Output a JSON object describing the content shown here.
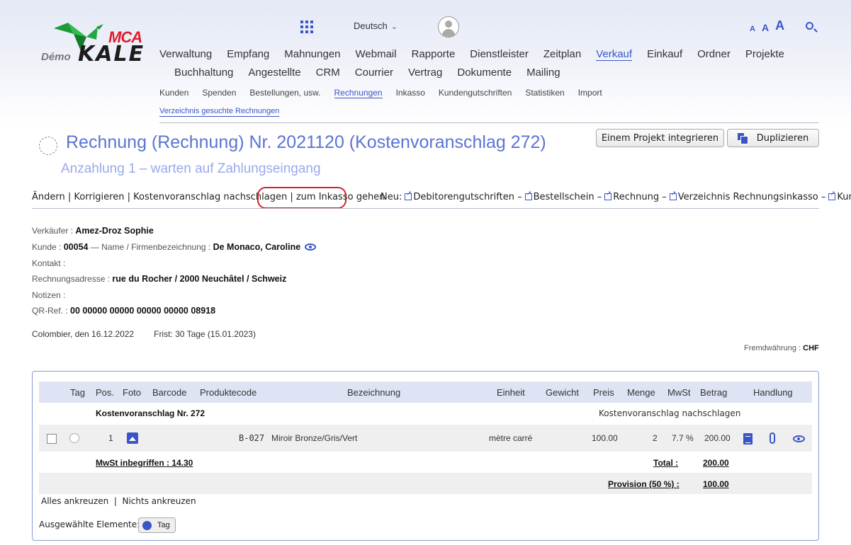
{
  "logo": {
    "brand_top": "MCA",
    "brand_prefix": "Démo",
    "brand_main": "KALE"
  },
  "header": {
    "language": "Deutsch",
    "font_sizes": [
      "A",
      "A",
      "A"
    ]
  },
  "nav_main": [
    "Verwaltung",
    "Empfang",
    "Mahnungen",
    "Webmail",
    "Rapporte",
    "Dienstleister",
    "Zeitplan",
    "Verkauf",
    "Einkauf",
    "Ordner",
    "Projekte"
  ],
  "nav_main_row2": [
    "Buchhaltung",
    "Angestellte",
    "CRM",
    "Courrier",
    "Vertrag",
    "Dokumente",
    "Mailing"
  ],
  "nav_sub": [
    "Kunden",
    "Spenden",
    "Bestellungen, usw.",
    "Rechnungen",
    "Inkasso",
    "Kundengutschriften",
    "Statistiken",
    "Import"
  ],
  "nav_sub2": "Verzeichnis gesuchte Rechnungen",
  "page": {
    "title": "Rechnung (Rechnung) Nr. 2021120 (Kostenvoranschlag 272)",
    "subtitle": "Anzahlung 1 – warten auf Zahlungseingang",
    "btn_integrate": "Einem Projekt integrieren",
    "btn_duplicate": "Duplizieren"
  },
  "actions": {
    "aendern": "Ändern",
    "korrigieren": "Korrigieren",
    "kv": "Kostenvoranschlag nachschlagen",
    "inkasso": "zum Inkasso gehen",
    "neu_label": "Neu:",
    "neu_links": [
      "Debitorengutschriften",
      "Bestellschein",
      "Rechnung",
      "Verzeichnis Rechnungsinkasso",
      "Kunde"
    ]
  },
  "info": {
    "verkaeufer_label": "Verkäufer :",
    "verkaeufer": "Amez-Droz Sophie",
    "kunde_label": "Kunde :",
    "kunde_nr": "00054",
    "name_label": "— Name / Firmenbezeichnung :",
    "kunde_name": "De Monaco, Caroline",
    "kontakt_label": "Kontakt :",
    "adresse_label": "Rechnungsadresse :",
    "adresse": "rue du Rocher / 2000 Neuchâtel / Schweiz",
    "notizen_label": "Notizen :",
    "qr_label": "QR-Ref. :",
    "qr": "00 00000 00000 00000 00000 08918"
  },
  "date_line": "Colombier, den 16.12.2022",
  "frist": "Frist: 30 Tage (15.01.2023)",
  "currency": {
    "label": "Fremdwährung :",
    "value": "CHF"
  },
  "table": {
    "headers": [
      "Tag",
      "Pos.",
      "Foto",
      "Barcode",
      "Produktecode",
      "Bezeichnung",
      "Einheit",
      "Gewicht",
      "Preis",
      "Menge",
      "MwSt",
      "Betrag",
      "Handlung"
    ],
    "group_label": "Kostenvoranschlag Nr. 272",
    "group_link": "Kostenvoranschlag nachschlagen",
    "row": {
      "pos": "1",
      "code": "B-027",
      "bezeichnung": "Miroir Bronze/Gris/Vert",
      "einheit": "mètre carré",
      "preis": "100.00",
      "menge": "2",
      "mwst": "7.7 %",
      "betrag": "200.00"
    },
    "mwst_incl": "MwSt inbegriffen : 14.30",
    "total_label": "Total :",
    "total": "200.00",
    "provision_label": "Provision (50 %) :",
    "provision": "100.00"
  },
  "selection": {
    "all": "Alles ankreuzen",
    "none": "Nichts ankreuzen",
    "selected_label": "Ausgewählte Elemente:",
    "tag_btn": "Tag"
  },
  "colors": {
    "accent": "#3a55c4",
    "highlight": "#d0232e"
  }
}
